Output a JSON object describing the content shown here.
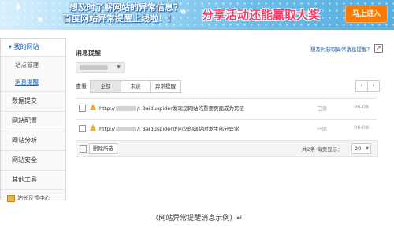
{
  "banner": {
    "line1": "想及时了解网站的异常信息？",
    "line2": "百度网站异常提醒上线啦！！",
    "promo": "分享活动还能赢取大奖",
    "cta": "马上进入"
  },
  "sidebar": {
    "header": "我的网站",
    "items": [
      {
        "label": "站点管理"
      },
      {
        "label": "消息提醒"
      }
    ],
    "groups": [
      {
        "label": "数据提交"
      },
      {
        "label": "网站配置"
      },
      {
        "label": "网站分析"
      },
      {
        "label": "网站安全"
      },
      {
        "label": "其他工具"
      }
    ],
    "footer": "站长反馈中心"
  },
  "main": {
    "title": "消息提醒",
    "howto_link": "想及时获取异常消息提醒？",
    "filter_label": "查看",
    "filters": [
      {
        "label": "全部",
        "active": true
      },
      {
        "label": "未读",
        "active": false
      },
      {
        "label": "异常提醒",
        "active": false
      }
    ],
    "prev": "‹",
    "next": "›",
    "messages": [
      {
        "prefix": "http://",
        "text": "/: Baiduspider发现您网站的重要页面成为死链",
        "status": "已读",
        "date": "06-08"
      },
      {
        "prefix": "http://",
        "text": "/: Baiduspider访问您的网站时发生部分异常",
        "status": "已读",
        "date": "06-08"
      }
    ],
    "delete_label": "删除所选",
    "total_text": "共2条  每页显示：",
    "page_size": "20"
  },
  "caption": "（网站异常提醒消息示例）↵"
}
